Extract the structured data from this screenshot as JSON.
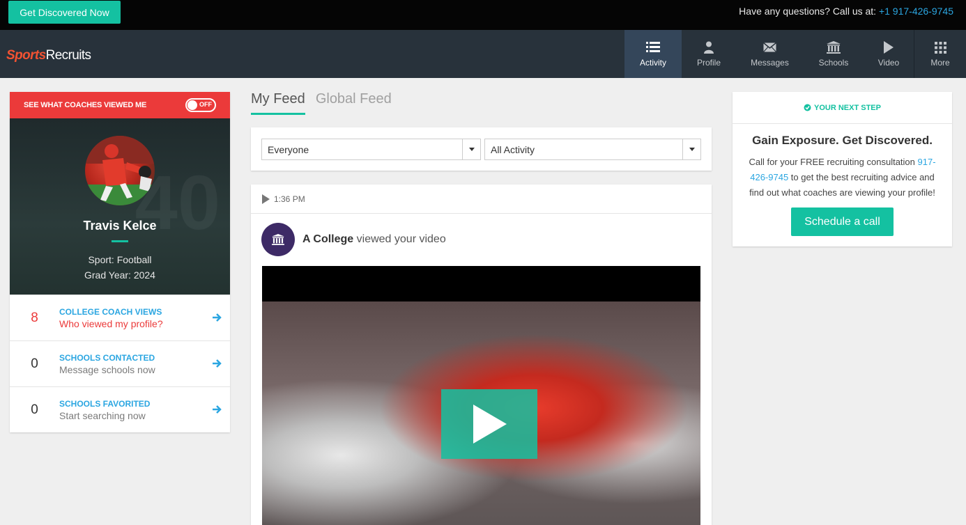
{
  "topbar": {
    "cta_label": "Get Discovered Now",
    "questions_label": "Have any questions? Call us at: ",
    "phone": "+1 917-426-9745"
  },
  "brand": {
    "part1": "Sports",
    "part2": "Recruits"
  },
  "nav": {
    "items": [
      {
        "label": "Activity",
        "icon": "list-icon",
        "active": true
      },
      {
        "label": "Profile",
        "icon": "person-icon",
        "active": false
      },
      {
        "label": "Messages",
        "icon": "envelope-icon",
        "active": false
      },
      {
        "label": "Schools",
        "icon": "bank-icon",
        "active": false
      },
      {
        "label": "Video",
        "icon": "play-icon",
        "active": false
      },
      {
        "label": "More",
        "icon": "grid-icon",
        "active": false
      }
    ]
  },
  "coach_views_banner": {
    "label": "SEE WHAT COACHES VIEWED ME",
    "toggle_state": "OFF"
  },
  "athlete": {
    "name": "Travis Kelce",
    "sport": "Sport: Football",
    "grad_year": "Grad Year: 2024",
    "jersey_bg": "40"
  },
  "stats": [
    {
      "count": "8",
      "title": "COLLEGE COACH VIEWS",
      "subtitle": "Who viewed my profile?"
    },
    {
      "count": "0",
      "title": "SCHOOLS CONTACTED",
      "subtitle": "Message schools now"
    },
    {
      "count": "0",
      "title": "SCHOOLS FAVORITED",
      "subtitle": "Start searching now"
    }
  ],
  "feed_tabs": {
    "my_feed": "My Feed",
    "global_feed": "Global Feed"
  },
  "filters": {
    "audience": "Everyone",
    "activity": "All Activity"
  },
  "feed_item": {
    "time": "1:36 PM",
    "actor": "A College",
    "action": " viewed your video"
  },
  "next_step": {
    "header": "YOUR NEXT STEP",
    "title": "Gain Exposure. Get Discovered.",
    "text_before": "Call for your FREE recruiting consultation ",
    "phone": "917-426-9745",
    "text_after": " to get the best recruiting advice and find out what coaches are viewing your profile!",
    "button_label": "Schedule a call"
  },
  "colors": {
    "accent": "#14c1a1",
    "link": "#2ba6e1",
    "alert": "#eb3a3a",
    "nav_bg": "#28323b"
  }
}
